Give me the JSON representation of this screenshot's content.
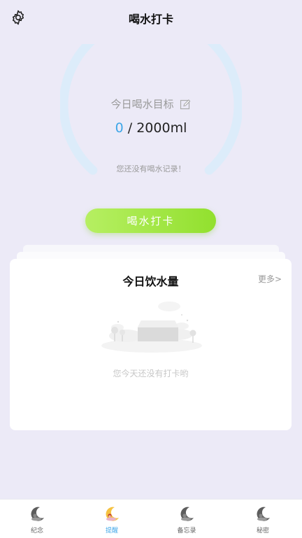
{
  "header": {
    "title": "喝水打卡",
    "settings_icon": "gear-icon"
  },
  "goal": {
    "label": "今日喝水目标",
    "edit_icon": "edit-icon",
    "current": "0",
    "separator": " / ",
    "target": "2000ml",
    "progress_fraction": 0,
    "empty_hint": "您还没有喝水记录！"
  },
  "checkin_button": "喝水打卡",
  "today_card": {
    "title": "今日饮水量",
    "more": "更多>",
    "empty_text": "您今天还没有打卡哟",
    "illustration": "empty-box-illustration"
  },
  "tabs": [
    {
      "label": "纪念",
      "icon": "moon-figure-icon",
      "active": false
    },
    {
      "label": "提醒",
      "icon": "moon-figure-icon",
      "active": true
    },
    {
      "label": "备忘录",
      "icon": "moon-figure-icon",
      "active": false
    },
    {
      "label": "秘密",
      "icon": "moon-figure-icon",
      "active": false
    }
  ],
  "colors": {
    "background": "#eceaf7",
    "accent_blue": "#3fa7e8",
    "button_green": "#a4e84a",
    "gauge_track": "#dcecfa",
    "tab_active_icon": "#f5c242"
  }
}
